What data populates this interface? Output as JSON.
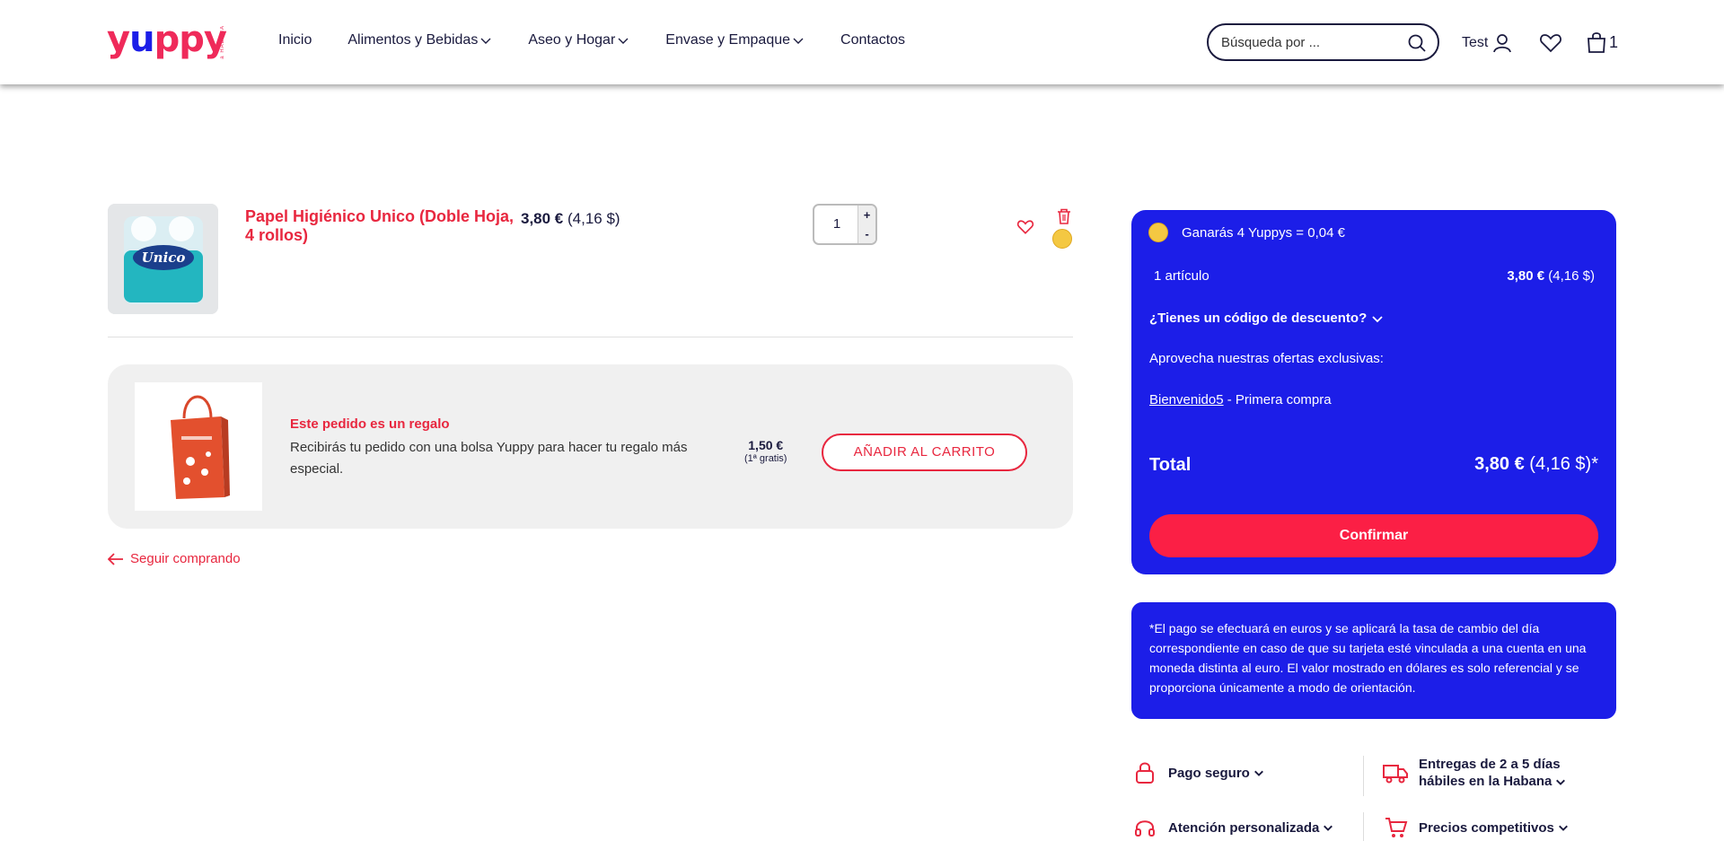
{
  "header": {
    "logo_text": "yuppy",
    "logo_sub": "a HABANA",
    "nav": [
      {
        "label": "Inicio",
        "dropdown": false
      },
      {
        "label": "Alimentos y Bebidas",
        "dropdown": true
      },
      {
        "label": "Aseo y Hogar",
        "dropdown": true
      },
      {
        "label": "Envase y Empaque",
        "dropdown": true
      },
      {
        "label": "Contactos",
        "dropdown": false
      }
    ],
    "search_placeholder": "Búsqueda por ...",
    "user_name": "Test",
    "cart_count": "1"
  },
  "cart_item": {
    "name": "Papel Higiénico Unico (Doble Hoja, 4 rollos)",
    "price_eur": "3,80 €",
    "price_usd": "(4,16 $)",
    "quantity": "1",
    "plus": "+",
    "minus": "-"
  },
  "gift": {
    "title": "Este pedido es un regalo",
    "description": "Recibirás tu pedido con una bolsa Yuppy para hacer tu regalo más especial.",
    "price": "1,50 €",
    "price_note": "(1ª gratis)",
    "button": "AÑADIR AL CARRITO"
  },
  "continue_label": "Seguir comprando",
  "summary": {
    "earn": "Ganarás 4 Yuppys = 0,04 €",
    "items_label": "1 artículo",
    "items_price_eur": "3,80 €",
    "items_price_usd": "(4,16 $)",
    "discount_label": "¿Tienes un código de descuento?",
    "offers_label": "Aprovecha nuestras ofertas exclusivas:",
    "coupon_code": "Bienvenido5",
    "coupon_desc": " - Primera compra",
    "total_label": "Total",
    "total_eur": "3,80 €",
    "total_usd": "(4,16 $)*",
    "confirm": "Confirmar"
  },
  "note": "*El pago se efectuará en euros y se aplicará la tasa de cambio del día correspondiente en caso de que su tarjeta esté vinculada a una cuenta en una moneda distinta al euro. El valor mostrado en dólares es solo referencial y se proporciona únicamente a modo de orientación.",
  "features": [
    {
      "label": "Pago seguro",
      "icon": "lock-icon"
    },
    {
      "label_line1": "Entregas de 2 a 5 días",
      "label_line2": "hábiles en la Habana",
      "icon": "truck-icon"
    },
    {
      "label": "Atención personalizada",
      "icon": "headset-icon"
    },
    {
      "label": "Precios competitivos",
      "icon": "cart-icon"
    }
  ],
  "colors": {
    "brand_red": "#e8273f",
    "brand_blue": "#1c1ee8",
    "confirm_red": "#fb1f45"
  }
}
